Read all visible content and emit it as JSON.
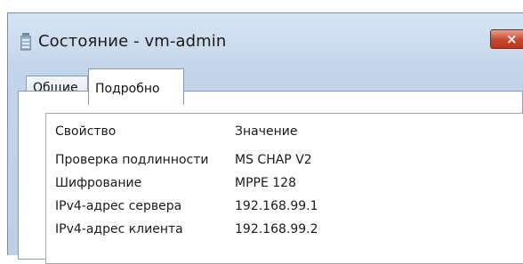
{
  "window": {
    "title": "Состояние - vm-admin",
    "close_label": "×"
  },
  "tabs": [
    {
      "label": "Общие"
    },
    {
      "label": "Подробно"
    }
  ],
  "details": {
    "headers": {
      "property": "Свойство",
      "value": "Значение"
    },
    "rows": [
      {
        "property": "Проверка подлинности",
        "value": "MS CHAP V2"
      },
      {
        "property": "Шифрование",
        "value": "MPPE 128"
      },
      {
        "property": "IPv4-адрес сервера",
        "value": "192.168.99.1"
      },
      {
        "property": "IPv4-адрес клиента",
        "value": "192.168.99.2"
      }
    ]
  }
}
